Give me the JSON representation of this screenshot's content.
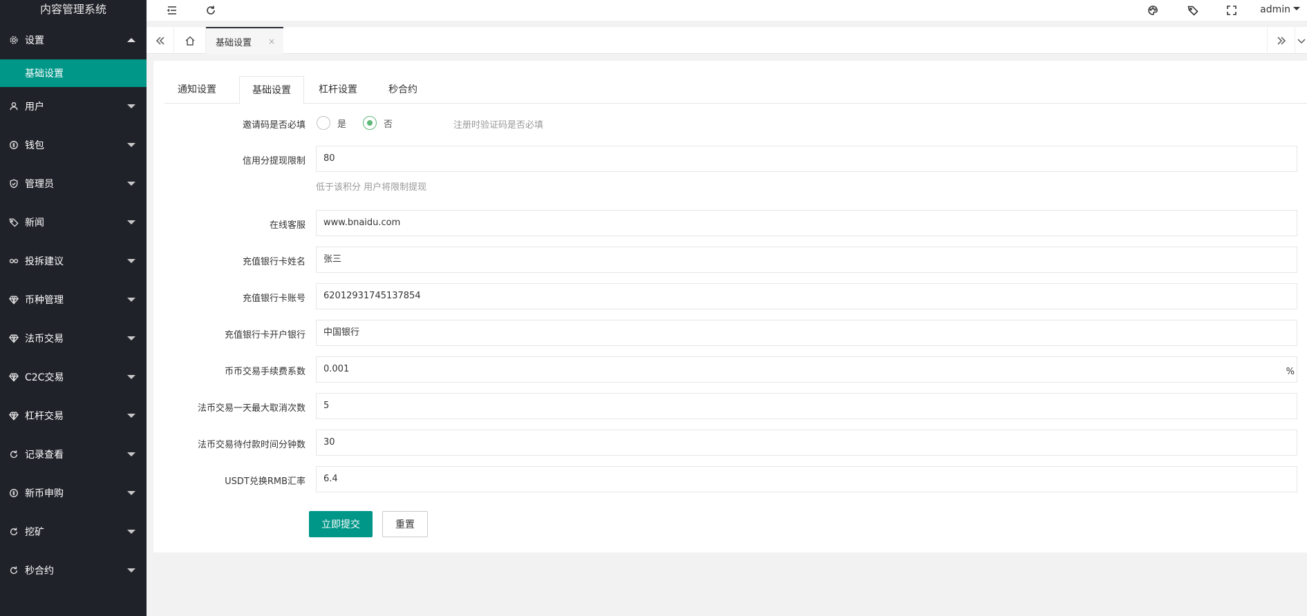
{
  "app": {
    "title": "内容管理系统"
  },
  "sidebar": {
    "items": [
      {
        "label": "设置",
        "icon": "gear-icon",
        "expanded": true,
        "children": [
          {
            "label": "基础设置"
          }
        ]
      },
      {
        "label": "用户",
        "icon": "user-icon"
      },
      {
        "label": "钱包",
        "icon": "coin-icon"
      },
      {
        "label": "管理员",
        "icon": "shield-icon"
      },
      {
        "label": "新闻",
        "icon": "tag-icon"
      },
      {
        "label": "投拆建议",
        "icon": "link-icon"
      },
      {
        "label": "币种管理",
        "icon": "diamond-icon"
      },
      {
        "label": "法币交易",
        "icon": "diamond-icon"
      },
      {
        "label": "C2C交易",
        "icon": "diamond-icon"
      },
      {
        "label": "杠杆交易",
        "icon": "diamond-icon"
      },
      {
        "label": "记录查看",
        "icon": "refresh-icon"
      },
      {
        "label": "新币申购",
        "icon": "coin-icon"
      },
      {
        "label": "挖矿",
        "icon": "refresh-icon"
      },
      {
        "label": "秒合约",
        "icon": "refresh-icon"
      }
    ]
  },
  "topbar": {
    "user": "admin",
    "icons": [
      "menu-collapse-icon",
      "refresh-icon",
      "palette-icon",
      "tag-icon",
      "fullscreen-icon"
    ]
  },
  "tabsbar": {
    "active_tab": "基础设置",
    "close_glyph": "×"
  },
  "subtabs": [
    "通知设置",
    "基础设置",
    "杠杆设置",
    "秒合约"
  ],
  "active_subtab": 1,
  "form": {
    "invite_label": "邀请码是否必填",
    "invite_yes": "是",
    "invite_no": "否",
    "invite_selected": "否",
    "invite_hint": "注册时验证码是否必填",
    "credit_label": "信用分提现限制",
    "credit_value": "80",
    "credit_hint": "低于该积分 用户将限制提现",
    "service_label": "在线客服",
    "service_value": "www.bnaidu.com",
    "bank_name_label": "充值银行卡姓名",
    "bank_name_value": "张三",
    "bank_no_label": "充值银行卡账号",
    "bank_no_value": "62012931745137854",
    "bank_open_label": "充值银行卡开户银行",
    "bank_open_value": "中国银行",
    "fee_label": "币币交易手续费系数",
    "fee_value": "0.001",
    "fee_suffix": "%",
    "cancel_label": "法币交易一天最大取消次数",
    "cancel_value": "5",
    "wait_label": "法币交易待付款时间分钟数",
    "wait_value": "30",
    "rate_label": "USDT兑换RMB汇率",
    "rate_value": "6.4",
    "submit_label": "立即提交",
    "reset_label": "重置"
  },
  "colors": {
    "sidebar_bg": "#20222a",
    "accent": "#009688",
    "radio_on": "#5fb878"
  }
}
